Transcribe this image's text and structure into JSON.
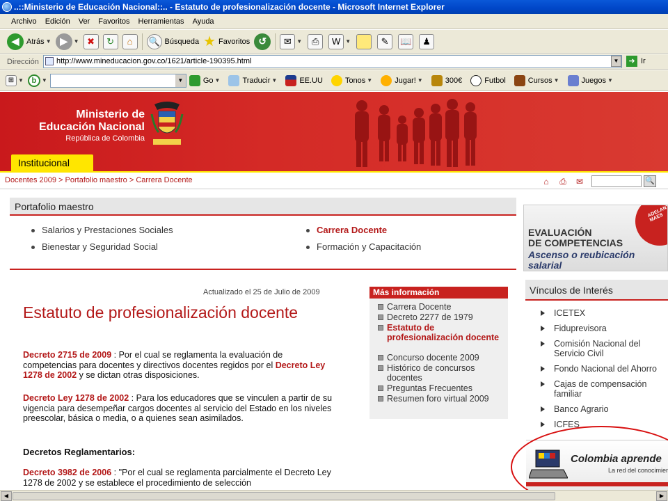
{
  "window": {
    "title": "..::Ministerio de Educación Nacional::.. - Estatuto de profesionalización docente - Microsoft Internet Explorer"
  },
  "menu": [
    "Archivo",
    "Edición",
    "Ver",
    "Favoritos",
    "Herramientas",
    "Ayuda"
  ],
  "toolbar": {
    "back_label": "Atrás",
    "search_label": "Búsqueda",
    "favorites_label": "Favoritos"
  },
  "address": {
    "label": "Dirección",
    "url": "http://www.mineducacion.gov.co/1621/article-190395.html",
    "go_label": "Ir"
  },
  "links_bar": {
    "go": "Go",
    "translate": "Traducir",
    "usa": "EE.UU",
    "tones": "Tonos",
    "play": "Jugar!",
    "money": "300€",
    "football": "Futbol",
    "courses": "Cursos",
    "games": "Juegos"
  },
  "header": {
    "ministry_line1": "Ministerio de",
    "ministry_line2": "Educación Nacional",
    "ministry_line3": "República de Colombia",
    "tab": "Institucional"
  },
  "breadcrumb": "Docentes 2009 > Portafolio maestro > Carrera Docente",
  "portafolio": {
    "title": "Portafolio maestro",
    "items": [
      {
        "label": "Salarios y Prestaciones Sociales"
      },
      {
        "label": "Bienestar y Seguridad Social"
      },
      {
        "label": "Carrera Docente"
      },
      {
        "label": "Formación y Capacitación"
      }
    ]
  },
  "article": {
    "updated": "Actualizado el 25 de Julio de 2009",
    "title": "Estatuto de profesionalización docente",
    "p1_link1": "Decreto 2715 de 2009",
    "p1_text1": " : Por el cual se reglamenta la evaluación de competencias para docentes y directivos docentes regidos por el ",
    "p1_link2": "Decreto Ley 1278 de 2002",
    "p1_text2": " y se dictan otras disposiciones.",
    "p2_link": "Decreto Ley 1278 de 2002",
    "p2_text": " : Para los educadores que se vinculen a partir de su vigencia para desempeñar cargos docentes al servicio del Estado en los niveles preescolar, básica o media, o a quienes sean asimilados.",
    "subhead": "Decretos Reglamentarios:",
    "p3_link": "Decreto 3982 de 2006",
    "p3_text": " : \"Por el cual se reglamenta parcialmente el Decreto Ley 1278 de 2002 y se establece el procedimiento de selección"
  },
  "mas_info": {
    "title": "Más información",
    "items": [
      {
        "label": "Carrera Docente"
      },
      {
        "label": "Decreto 2277 de 1979"
      },
      {
        "label": "Estatuto de profesionalización docente"
      },
      {
        "label": "Concurso docente 2009"
      },
      {
        "label": "Histórico de concursos docentes"
      },
      {
        "label": "Preguntas Frecuentes"
      },
      {
        "label": "Resumen foro virtual 2009"
      }
    ]
  },
  "eval_banner": {
    "line1": "EVALUACIÓN",
    "line2": "DE COMPETENCIAS",
    "line3": "Ascenso o reubicación",
    "line4": "salarial",
    "badge": "ADELANTE MAES"
  },
  "vinculos": {
    "title": "Vínculos de Interés",
    "items": [
      {
        "label": "ICETEX"
      },
      {
        "label": "Fiduprevisora"
      },
      {
        "label": "Comisión Nacional del Servicio Civil"
      },
      {
        "label": "Fondo Nacional del Ahorro"
      },
      {
        "label": "Cajas de compensación familiar"
      },
      {
        "label": "Banco Agrario"
      },
      {
        "label": "ICFES"
      }
    ]
  },
  "colombia_aprende": {
    "title": "Colombia aprende",
    "subtitle": "La red del conocimiento"
  }
}
